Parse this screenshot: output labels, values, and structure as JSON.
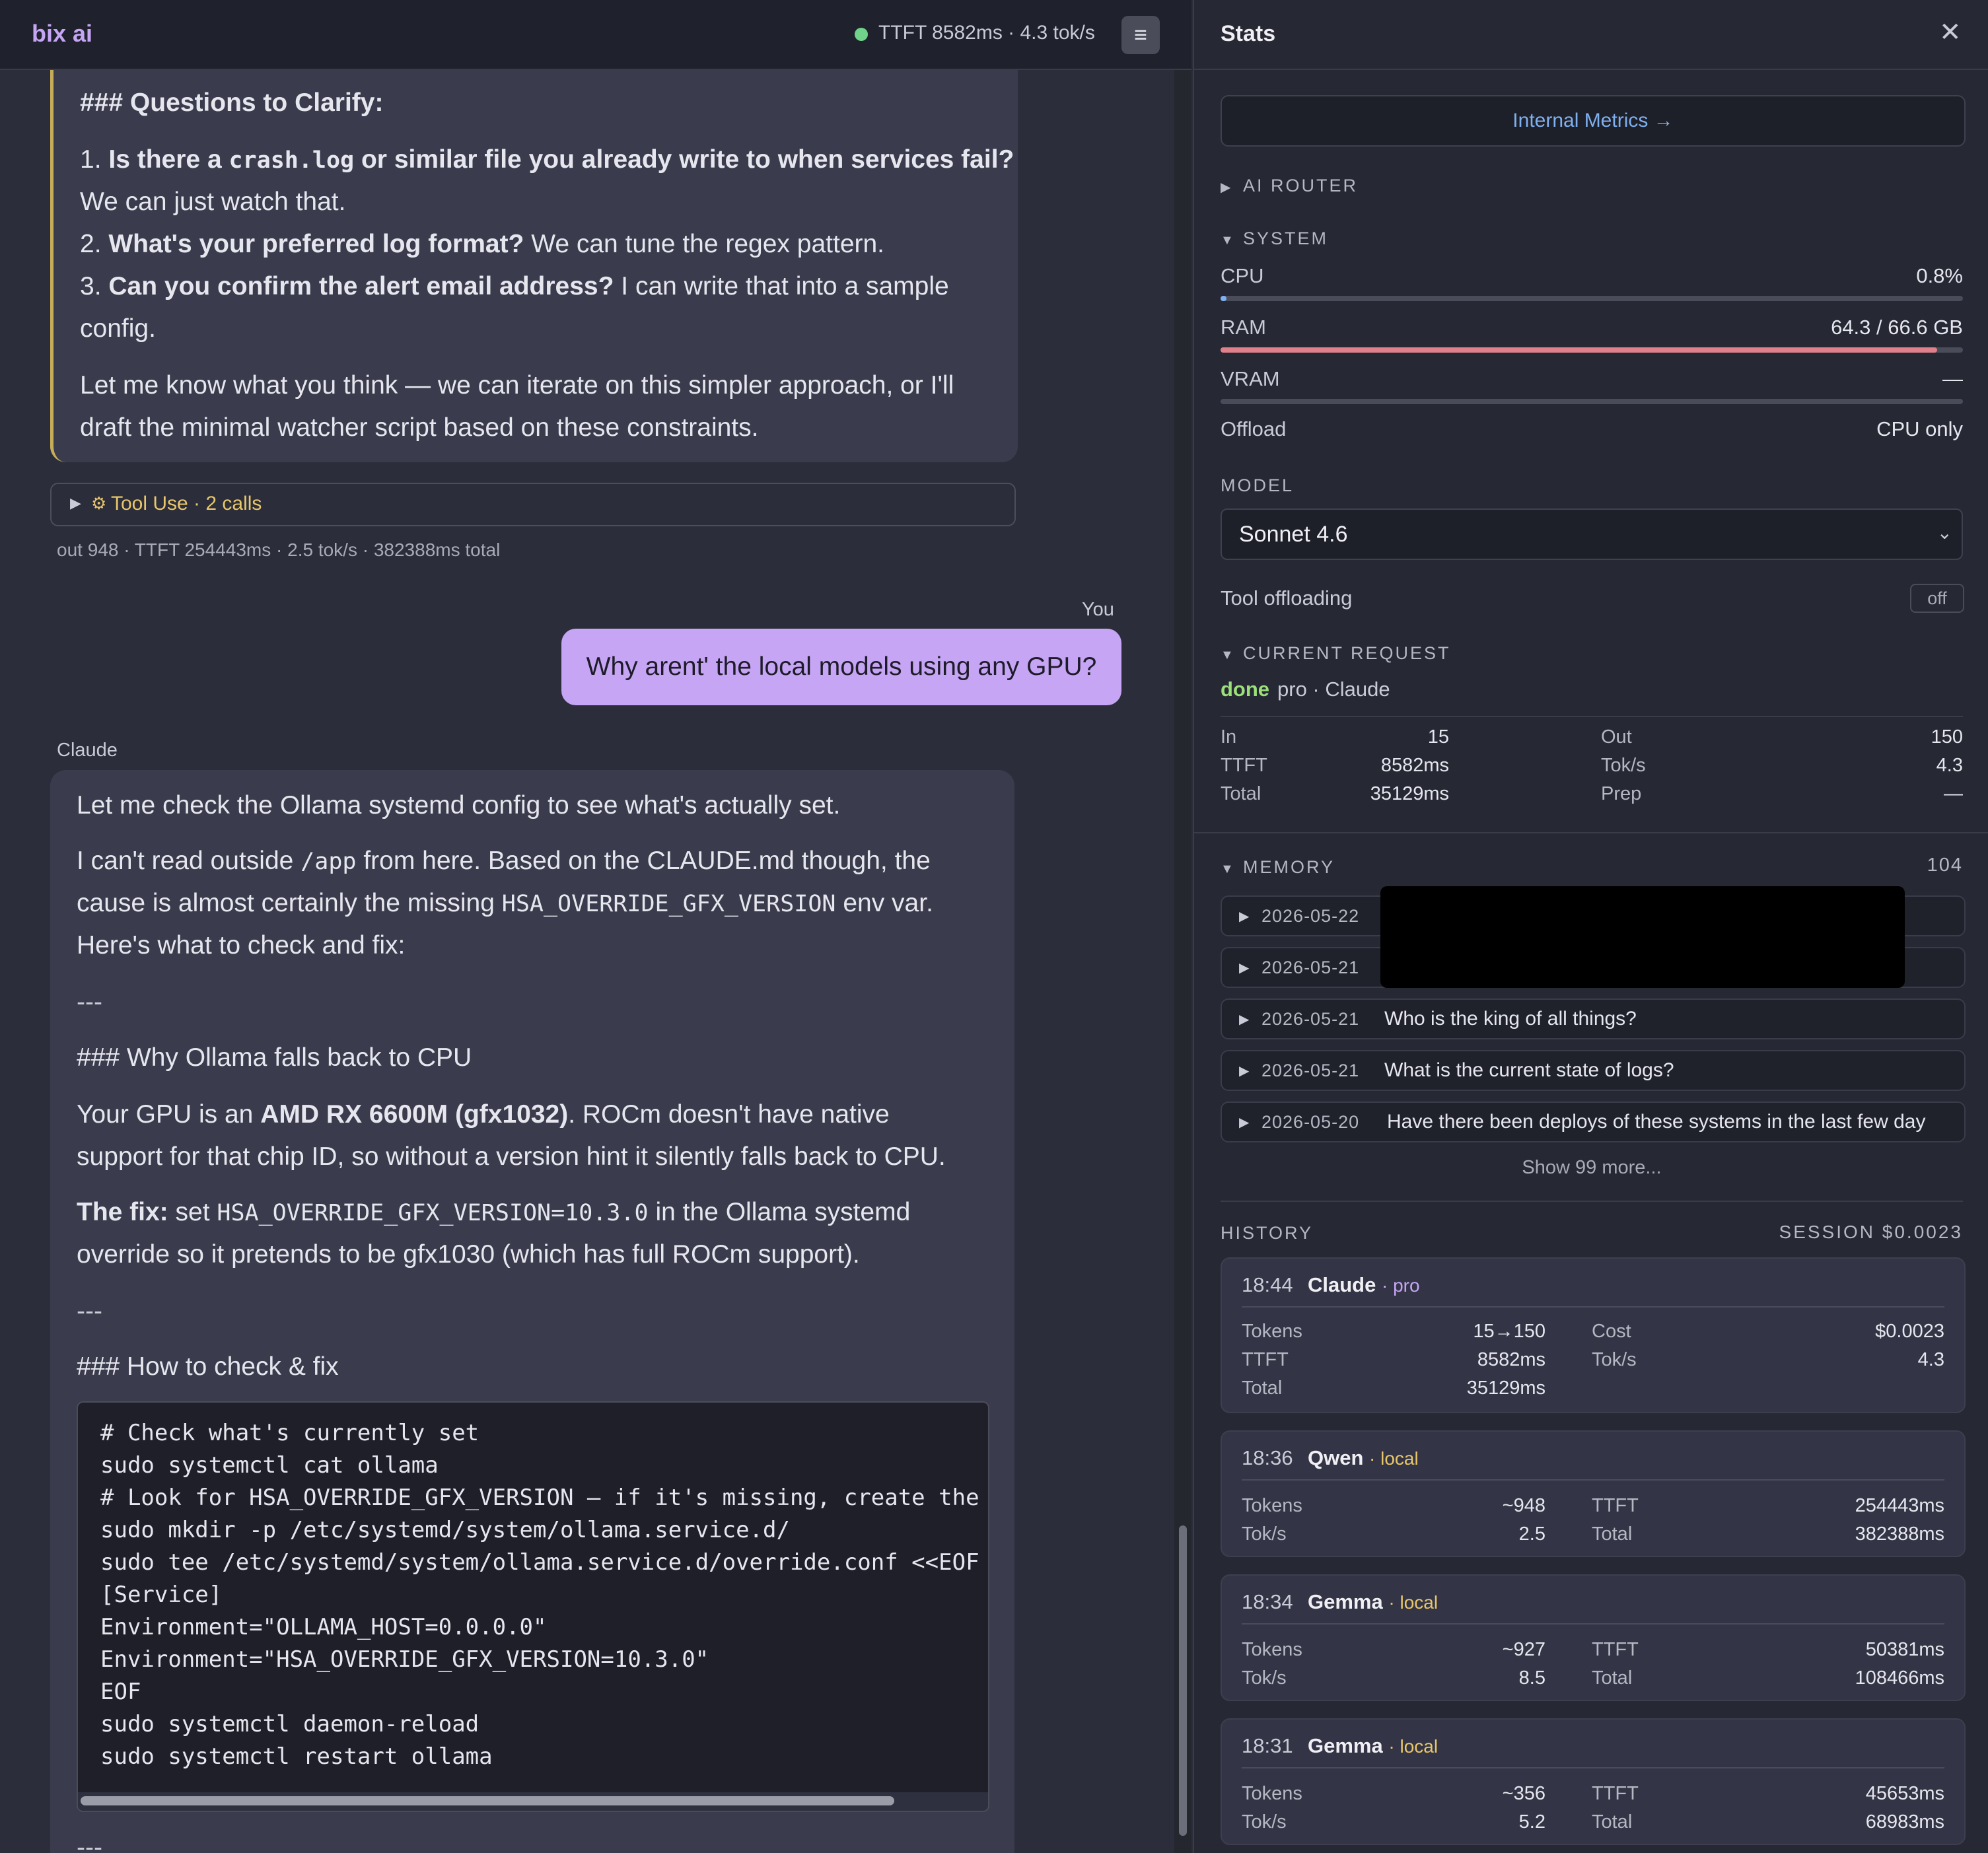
{
  "app": {
    "title": "bix ai",
    "status_text": "TTFT 8582ms · 4.3 tok/s",
    "menu_icon": "≡"
  },
  "colors": {
    "accent": "#c6a6f4",
    "status_ok": "#6fd48a",
    "ram_bar": "#e0808a",
    "tool_use": "#e8c66a",
    "done": "#9be07a",
    "link": "#7fb0f0"
  },
  "chat": {
    "prev": {
      "heading": "### Questions to Clarify:",
      "q1_num": "1.",
      "q1_a": "Is there a",
      "q1_code": "crash.log",
      "q1_b": "or similar file you already write to when services fail?",
      "q1_cont": "We can just watch that.",
      "q2_num": "2.",
      "q2_bold": "What's your preferred log format?",
      "q2_rest": "We can tune the regex pattern.",
      "q3_num": "3.",
      "q3_bold": "Can you confirm the alert email address?",
      "q3_rest": "I can write that into a sample",
      "q3_cont": "config.",
      "closing_1": "Let me know what you think — we can iterate on this simpler approach, or I'll",
      "closing_2": "draft the minimal watcher script based on these constraints."
    },
    "tool_use": {
      "label": "Tool Use · 2 calls"
    },
    "msg_stats": "out 948 · TTFT 254443ms · 2.5 tok/s · 382388ms total",
    "user_label": "You",
    "user_message": "Why arent' the local models using any GPU?",
    "assistant_label": "Claude",
    "assistant": {
      "p1": "Let me check the Ollama systemd config to see what's actually set.",
      "p2_a": "I can't read outside",
      "p2_code": "/app",
      "p2_b": "from here. Based on the CLAUDE.md though, the",
      "p2_c": "cause is almost certainly the missing",
      "p2_code2": "HSA_OVERRIDE_GFX_VERSION",
      "p2_d": "env var.",
      "p2_e": "Here's what to check and fix:",
      "hr": "---",
      "h1": "### Why Ollama falls back to CPU",
      "p3_a": "Your GPU is an",
      "p3_bold": "AMD RX 6600M (gfx1032)",
      "p3_b": ". ROCm doesn't have native",
      "p3_c": "support for that chip ID, so without a version hint it silently falls back to CPU.",
      "p4_bold": "The fix:",
      "p4_a": "set",
      "p4_code": "HSA_OVERRIDE_GFX_VERSION=10.3.0",
      "p4_b": "in the Ollama systemd",
      "p4_c": "override so it pretends to be gfx1030 (which has full ROCm support).",
      "h2": "### How to check & fix",
      "code": "# Check what's currently set\nsudo systemctl cat ollama\n# Look for HSA_OVERRIDE_GFX_VERSION — if it's missing, create the ove\nsudo mkdir -p /etc/systemd/system/ollama.service.d/\nsudo tee /etc/systemd/system/ollama.service.d/override.conf <<EOF\n[Service]\nEnvironment=\"OLLAMA_HOST=0.0.0.0\"\nEnvironment=\"HSA_OVERRIDE_GFX_VERSION=10.3.0\"\nEOF\nsudo systemctl daemon-reload\nsudo systemctl restart ollama"
    }
  },
  "stats": {
    "title": "Stats",
    "close_icon": "✕",
    "metrics_button": "Internal Metrics →",
    "sections": {
      "router": "AI ROUTER",
      "system": "SYSTEM",
      "model": "MODEL",
      "current_request": "CURRENT REQUEST",
      "memory": "MEMORY",
      "history": "HISTORY"
    },
    "system": {
      "cpu_label": "CPU",
      "cpu_value": "0.8%",
      "cpu_fraction": 0.008,
      "ram_label": "RAM",
      "ram_value": "64.3 / 66.6 GB",
      "ram_fraction": 0.965,
      "vram_label": "VRAM",
      "vram_value": "—",
      "offload_label": "Offload",
      "offload_value": "CPU only"
    },
    "model": {
      "selected": "Sonnet 4.6",
      "tool_offloading_label": "Tool offloading",
      "tool_offloading_value": "off"
    },
    "current_request": {
      "status": "done",
      "meta": "pro · Claude",
      "in_label": "In",
      "in_value": "15",
      "out_label": "Out",
      "out_value": "150",
      "ttft_label": "TTFT",
      "ttft_value": "8582ms",
      "toks_label": "Tok/s",
      "toks_value": "4.3",
      "total_label": "Total",
      "total_value": "35129ms",
      "prep_label": "Prep",
      "prep_value": "—"
    },
    "memory": {
      "count": "104",
      "items": [
        {
          "date": "2026-05-22",
          "text": ""
        },
        {
          "date": "2026-05-21",
          "text": ""
        },
        {
          "date": "2026-05-21",
          "text": "Who is the king of all things?"
        },
        {
          "date": "2026-05-21",
          "text": "What is the current state of logs?"
        },
        {
          "date": "2026-05-20",
          "text": "Have there been deploys of these systems in the last few day"
        }
      ],
      "show_more": "Show 99 more..."
    },
    "history": {
      "session": "SESSION $0.0023",
      "cards": [
        {
          "time": "18:44",
          "model": "Claude",
          "tag": "pro",
          "k1": "Tokens",
          "v1": "15→150",
          "k2": "Cost",
          "v2": "$0.0023",
          "k3": "TTFT",
          "v3": "8582ms",
          "k4": "Tok/s",
          "v4": "4.3",
          "k5": "Total",
          "v5": "35129ms"
        },
        {
          "time": "18:36",
          "model": "Qwen",
          "tag": "local",
          "k1": "Tokens",
          "v1": "~948",
          "k2": "TTFT",
          "v2": "254443ms",
          "k3": "Tok/s",
          "v3": "2.5",
          "k4": "Total",
          "v4": "382388ms"
        },
        {
          "time": "18:34",
          "model": "Gemma",
          "tag": "local",
          "k1": "Tokens",
          "v1": "~927",
          "k2": "TTFT",
          "v2": "50381ms",
          "k3": "Tok/s",
          "v3": "8.5",
          "k4": "Total",
          "v4": "108466ms"
        },
        {
          "time": "18:31",
          "model": "Gemma",
          "tag": "local",
          "k1": "Tokens",
          "v1": "~356",
          "k2": "TTFT",
          "v2": "45653ms",
          "k3": "Tok/s",
          "v3": "5.2",
          "k4": "Total",
          "v4": "68983ms"
        }
      ]
    }
  }
}
